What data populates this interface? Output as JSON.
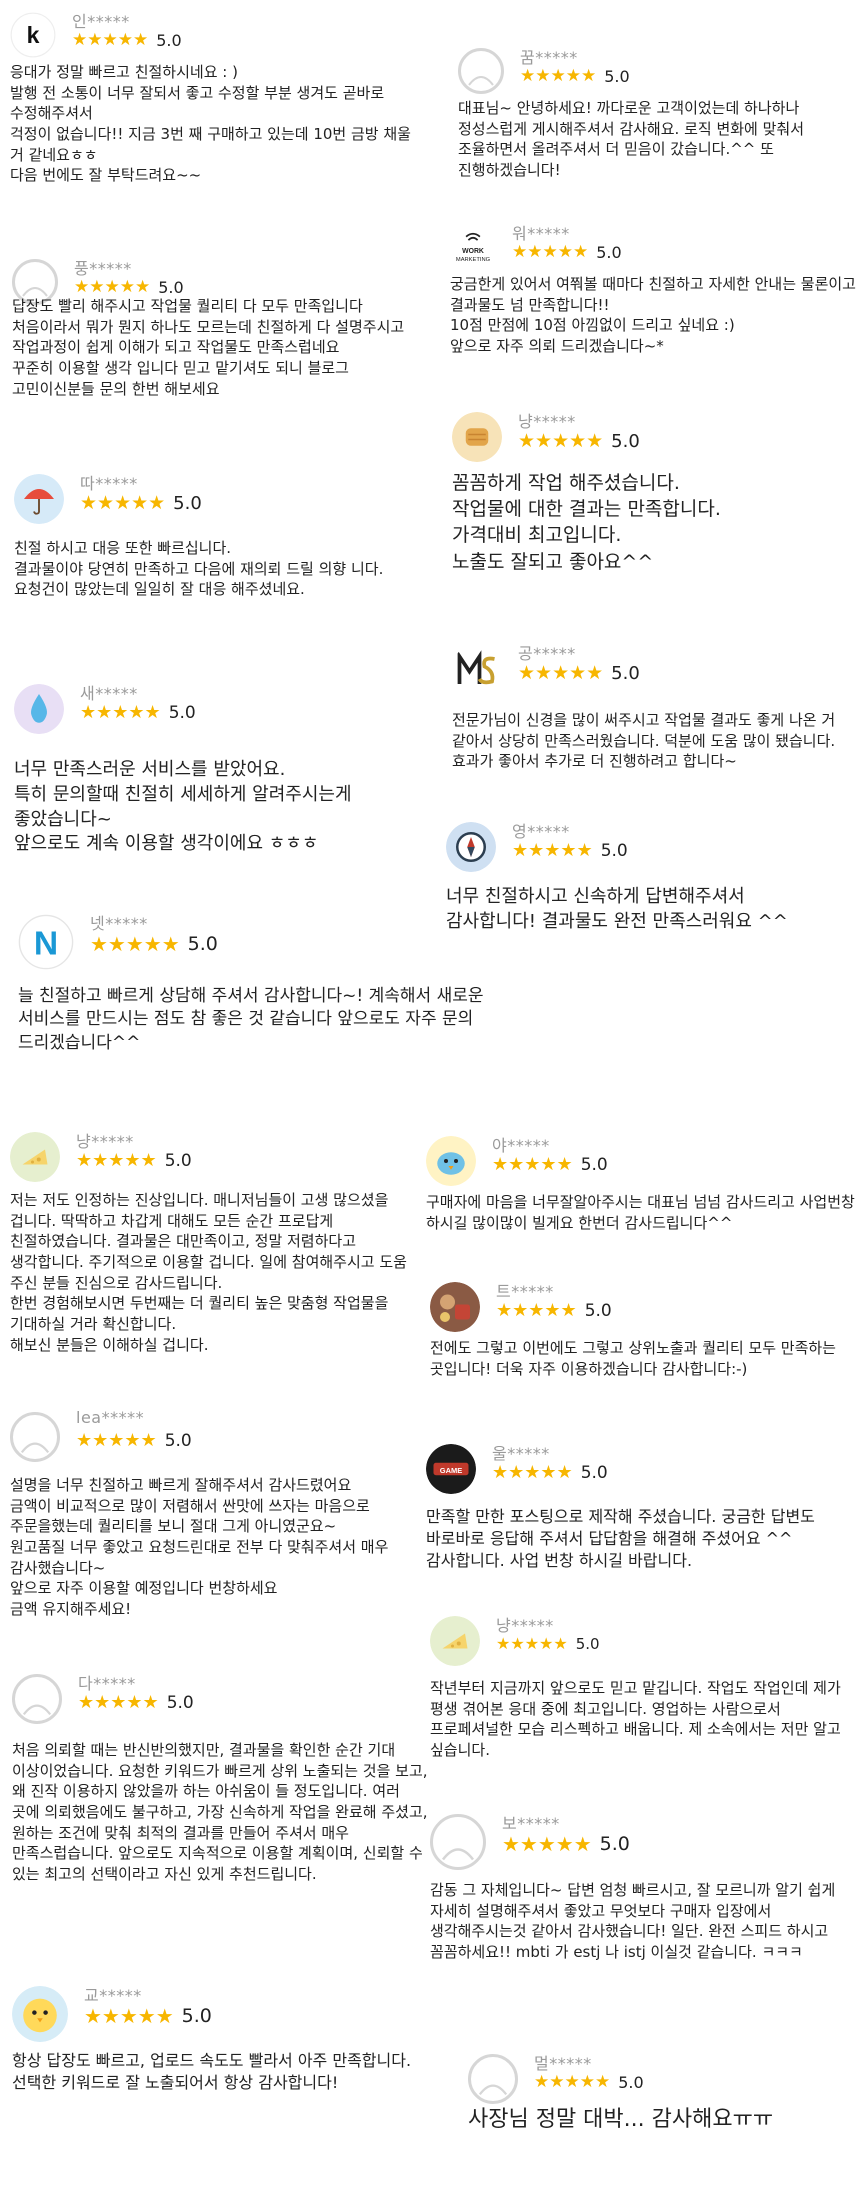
{
  "stars": "★★★★★",
  "colors": {
    "star": "#f7b600",
    "name": "#9a9a9a",
    "text": "#222222"
  },
  "reviews": [
    {
      "icon": "brand-k-logo-icon",
      "name": "인*****",
      "score": "5.0",
      "text": "응대가 정말 빠르고 친절하시네요 : )\n발행 전 소통이 너무 잘되서 좋고 수정할 부분 생겨도 곧바로 수정해주셔서\n걱정이 없습니다!! 지금 3번 째 구매하고 있는데 10번 금방 채울 거 같네요ㅎㅎ\n다음 번에도 잘 부탁드려요~~"
    },
    {
      "icon": "default-avatar-icon",
      "name": "꿈*****",
      "score": "5.0",
      "text": "대표님~ 안녕하세요! 까다로운 고객이었는데 하나하나 정성스럽게 게시해주셔서 감사해요. 로직 변화에 맞춰서 조율하면서 올려주셔서 더 믿음이 갔습니다.^^ 또 진행하겠습니다!"
    },
    {
      "icon": "work-marketing-logo-icon",
      "name": "워*****",
      "score": "5.0",
      "text": "궁금한게 있어서 여쭤볼 때마다 친절하고 자세한 안내는 물론이고 결과물도 넘 만족합니다!!\n10점 만점에 10점 아낌없이 드리고 싶네요 :)\n앞으로 자주 의뢰 드리겠습니다~*"
    },
    {
      "icon": "default-avatar-icon",
      "name": "풍*****",
      "score": "5.0",
      "text": "답장도 빨리 해주시고 작업물 퀄리티 다 모두 만족입니다\n처음이라서 뭐가 뭔지 하나도 모르는데 친절하게 다 설명주시고 작업과정이 쉽게 이해가 되고 작업물도 만족스럽네요\n꾸준히 이용할 생각 입니다 믿고 맡기셔도 되니 블로그 고민이신분들 문의 한번 해보세요"
    },
    {
      "icon": "bread-avatar-icon",
      "name": "냥*****",
      "score": "5.0",
      "text": "꼼꼼하게 작업 해주셨습니다.\n작업물에 대한 결과는 만족합니다.\n가격대비 최고입니다.\n노출도 잘되고 좋아요^^"
    },
    {
      "icon": "umbrella-avatar-icon",
      "name": "따*****",
      "score": "5.0",
      "text": "친절 하시고 대응 또한 빠르십니다.\n결과물이야 당연히 만족하고 다음에 재의뢰 드릴 의향 니다.\n요청건이 많았는데 일일히 잘 대응 해주셨네요."
    },
    {
      "icon": "ms-logo-icon",
      "name": "공*****",
      "score": "5.0",
      "text": "전문가님이 신경을 많이 써주시고 작업물 결과도 좋게 나온 거 같아서 상당히 만족스러웠습니다. 덕분에 도움 많이 됐습니다. 효과가 좋아서 추가로 더 진행하려고 합니다~"
    },
    {
      "icon": "water-drop-avatar-icon",
      "name": "새*****",
      "score": "5.0",
      "text": "너무 만족스러운 서비스를 받았어요.\n특히 문의할때 친절히 세세하게 알려주시는게 좋았습니다~\n앞으로도 계속 이용할 생각이에요 ㅎㅎㅎ"
    },
    {
      "icon": "compass-avatar-icon",
      "name": "영*****",
      "score": "5.0",
      "text": "너무 친절하시고 신속하게 답변해주셔서\n감사합니다! 결과물도 완전 만족스러워요 ^^"
    },
    {
      "icon": "n-letter-avatar-icon",
      "name": "넷*****",
      "score": "5.0",
      "text": "늘 친절하고 빠르게 상담해 주셔서 감사합니다~! 계속해서 새로운 서비스를 만드시는 점도 참 좋은 것 같습니다 앞으로도 자주 문의 드리겠습니다^^"
    },
    {
      "icon": "cheese-avatar-icon",
      "name": "냥*****",
      "score": "5.0",
      "text": "저는 저도 인정하는 진상입니다. 매니저님들이 고생 많으셨을 겁니다. 딱딱하고 차갑게 대해도 모든 순간 프로답게 친절하였습니다. 결과물은 대만족이고, 정말 저렴하다고 생각합니다. 주기적으로 이용할 겁니다. 일에 참여해주시고 도움 주신 분들 진심으로 감사드립니다.\n한번 경험해보시면 두번째는 더 퀄리티 높은 맞춤형 작업물을 기대하실 거라 확신합니다.\n해보신 분들은 이해하실 겁니다."
    },
    {
      "icon": "bird-avatar-icon",
      "name": "야*****",
      "score": "5.0",
      "text": "구매자에 마음을 너무잘알아주시는 대표님 넘넘 감사드리고 사업번창 하시길 많이많이 빌게요 한번더 감사드립니다^^"
    },
    {
      "icon": "photo-avatar-icon",
      "name": "트*****",
      "score": "5.0",
      "text": "전에도 그렇고 이번에도 그렇고 상위노출과 퀄리티 모두 만족하는 곳입니다! 더욱 자주 이용하겠습니다 감사합니다:-)"
    },
    {
      "icon": "default-avatar-icon",
      "name": "lea*****",
      "score": "5.0",
      "text": "설명을 너무 친절하고 빠르게 잘해주셔서 감사드렸어요\n금액이 비교적으로 많이 저렴해서 싼맛에 쓰자는 마음으로 주문을했는데 퀄리티를 보니 절대 그게 아니였군요~\n원고품질 너무 좋았고 요청드린대로 전부 다 맞춰주셔서 매우 감사했습니다~\n앞으로 자주 이용할 예정입니다 번창하세요\n금액 유지해주세요!"
    },
    {
      "icon": "gaming-logo-icon",
      "name": "울*****",
      "score": "5.0",
      "text": "만족할 만한 포스팅으로 제작해 주셨습니다.  궁금한 답변도 바로바로 응답해 주셔서 답답함을 해결해 주셨어요 ^^ 감사합니다. 사업 번창 하시길 바랍니다."
    },
    {
      "icon": "cheese-avatar-icon",
      "name": "냥*****",
      "score": "5.0",
      "text": "작년부터 지금까지 앞으로도 믿고 맡깁니다. 작업도 작업인데 제가 평생 겪어본 응대 중에 최고입니다. 영업하는 사람으로서 프로페셔널한 모습 리스펙하고 배웁니다. 제 소속에서는 저만 알고 싶습니다."
    },
    {
      "icon": "default-avatar-icon",
      "name": "다*****",
      "score": "5.0",
      "text": "처음 의뢰할 때는 반신반의했지만, 결과물을 확인한 순간 기대 이상이었습니다. 요청한 키워드가 빠르게 상위 노출되는 것을 보고, 왜 진작 이용하지 않았을까 하는 아쉬움이 들 정도입니다. 여러 곳에 의뢰했음에도 불구하고, 가장 신속하게 작업을 완료해 주셨고, 원하는 조건에 맞춰 최적의 결과를 만들어 주셔서 매우 만족스럽습니다. 앞으로도 지속적으로 이용할 계획이며, 신뢰할 수 있는 최고의 선택이라고 자신 있게 추천드립니다."
    },
    {
      "icon": "default-avatar-icon",
      "name": "보*****",
      "score": "5.0",
      "text": "감동 그 자체입니다~ 답변 엄청 빠르시고, 잘 모르니까 알기 쉽게 자세히 설명해주셔서 좋았고 무엇보다 구매자 입장에서 생각해주시는것 같아서 감사했습니다! 일단. 완전 스피드 하시고 꼼꼼하세요!! mbti 가 estj 나 istj 이실것 같습니다. ㅋㅋㅋ"
    },
    {
      "icon": "chick-avatar-icon",
      "name": "교*****",
      "score": "5.0",
      "text": "항상 답장도 빠르고, 업로드 속도도 빨라서 아주 만족합니다.\n선택한 키워드로 잘 노출되어서 항상 감사합니다!"
    },
    {
      "icon": "default-avatar-icon",
      "name": "멀*****",
      "score": "5.0",
      "text": "사장님 정말 대박... 감사해요ㅠㅠ"
    }
  ]
}
